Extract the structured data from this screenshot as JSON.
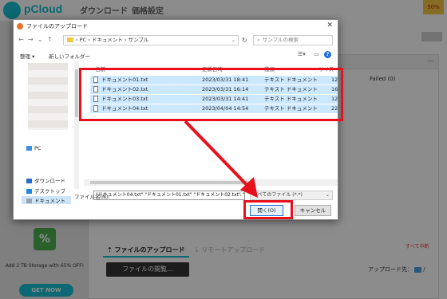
{
  "background": {
    "app_name": "pCloud",
    "nav": [
      "ダウンロード",
      "価格設定"
    ],
    "promo_badge": "50%",
    "shield_glyph": "%",
    "storage_promo": "Add 2 TB Storage with 65% OFF!",
    "get_now_label": "GET NOW",
    "accent_color": "#17bed0"
  },
  "upload_panel": {
    "failed_label": "Failed (0)",
    "cancel_all_label": "すべて中断",
    "tabs": [
      {
        "label": "⇡ ファイルのアップロード",
        "active": true
      },
      {
        "label": "⇣ リモートアップロード",
        "active": false
      }
    ],
    "open_files_button": "ファイルの開覧...",
    "destination_label": "アップロード先：",
    "destination_value": "/"
  },
  "dialog": {
    "title": "ファイルのアップロード",
    "close_glyph": "✕",
    "address_path": "›  PC  ›  ドキュメント  ›  サンプル",
    "search_placeholder": "サンプルの検索",
    "toolbar": {
      "organize": "整理 ▾",
      "new_folder": "新しいフォルダー"
    },
    "columns": {
      "name": "名前",
      "date": "更新日時",
      "type": "種類",
      "size": "サイズ"
    },
    "files": [
      {
        "name": "ドキュメント01.txt",
        "date": "2023/03/31 18:41",
        "type": "テキスト ドキュメント",
        "size": "12"
      },
      {
        "name": "ドキュメント02.txt",
        "date": "2023/03/31 16:14",
        "type": "テキスト ドキュメント",
        "size": "16"
      },
      {
        "name": "ドキュメント03.txt",
        "date": "2023/03/31 14:41",
        "type": "テキスト ドキュメント",
        "size": "12"
      },
      {
        "name": "ドキュメント04.txt",
        "date": "2023/04/04 14:54",
        "type": "テキスト ドキュメント",
        "size": "22"
      }
    ],
    "nav_items": [
      {
        "label": "PC",
        "icon": "pc-icon"
      },
      {
        "label": "ダウンロード",
        "icon": "download-icon"
      },
      {
        "label": "デスクトップ",
        "icon": "desktop-icon"
      },
      {
        "label": "ドキュメント",
        "icon": "documents-icon"
      }
    ],
    "filename_label": "ファイル名(N):",
    "filename_value": "\"ドキュメント04.txt\" \"ドキュメント01.txt\" \"ドキュメント02.txt\" \"ドキュメント",
    "filetype_value": "すべてのファイル (*.*)",
    "open_button": "開く(O)",
    "cancel_button": "キャンセル"
  },
  "annotation_color": "#e8101c"
}
